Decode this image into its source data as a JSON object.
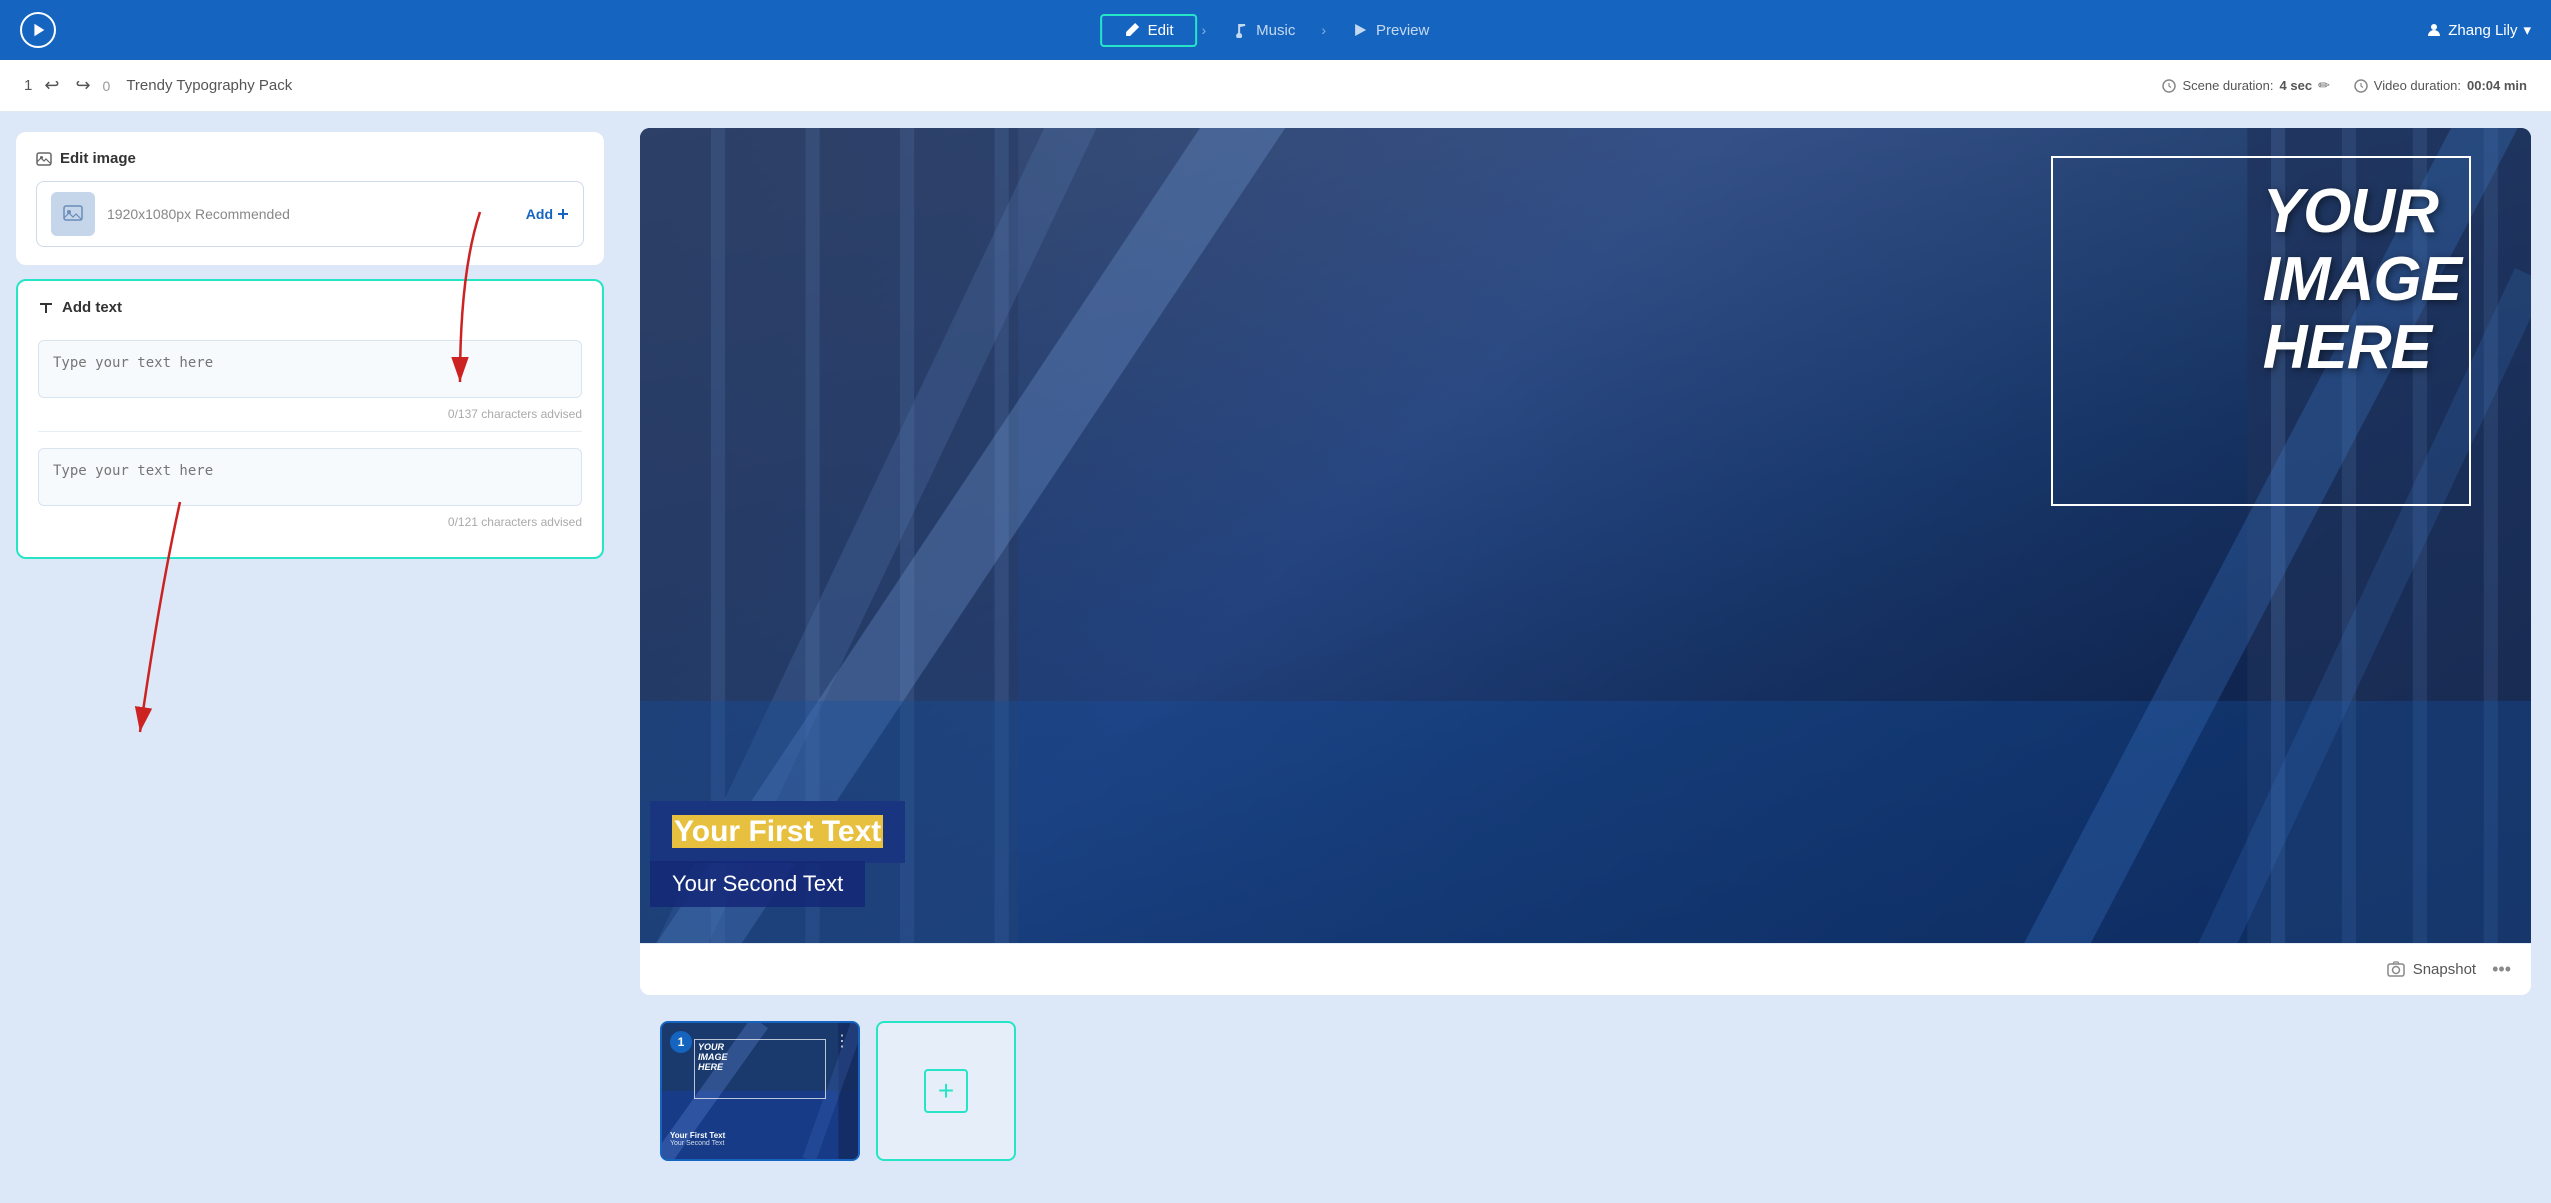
{
  "nav": {
    "steps": [
      {
        "id": "edit",
        "label": "Edit",
        "active": true
      },
      {
        "id": "music",
        "label": "Music",
        "active": false
      },
      {
        "id": "preview",
        "label": "Preview",
        "active": false
      }
    ],
    "user": {
      "name": "Zhang Lily",
      "chevron": "▾"
    }
  },
  "second_bar": {
    "step_number": "1",
    "redo_count": "0",
    "project_name": "Trendy Typography Pack",
    "scene_duration_label": "Scene duration:",
    "scene_duration_value": "4 sec",
    "video_duration_label": "Video duration:",
    "video_duration_value": "00:04 min"
  },
  "left_panel": {
    "edit_image": {
      "title": "Edit image",
      "upload_label": "1920x1080px Recommended",
      "add_button": "Add"
    },
    "add_text": {
      "title": "Add text",
      "first_input_placeholder": "Type your text here",
      "first_char_count": "0/137 characters advised",
      "second_input_placeholder": "Type your text here",
      "second_char_count": "0/121 characters advised"
    }
  },
  "preview": {
    "image_placeholder_text": "YOUR\nIMAGE\nHERE",
    "first_text": "Your First Text",
    "second_text": "Your Second Text",
    "snapshot_label": "Snapshot",
    "more_icon": "•••"
  },
  "timeline": {
    "scene_number": "1",
    "thumb_text1": "YOUR\nIMAGE\nHERE",
    "thumb_first_text": "Your First Text",
    "thumb_second_text": "Your Second Text",
    "add_scene_plus": "+"
  }
}
